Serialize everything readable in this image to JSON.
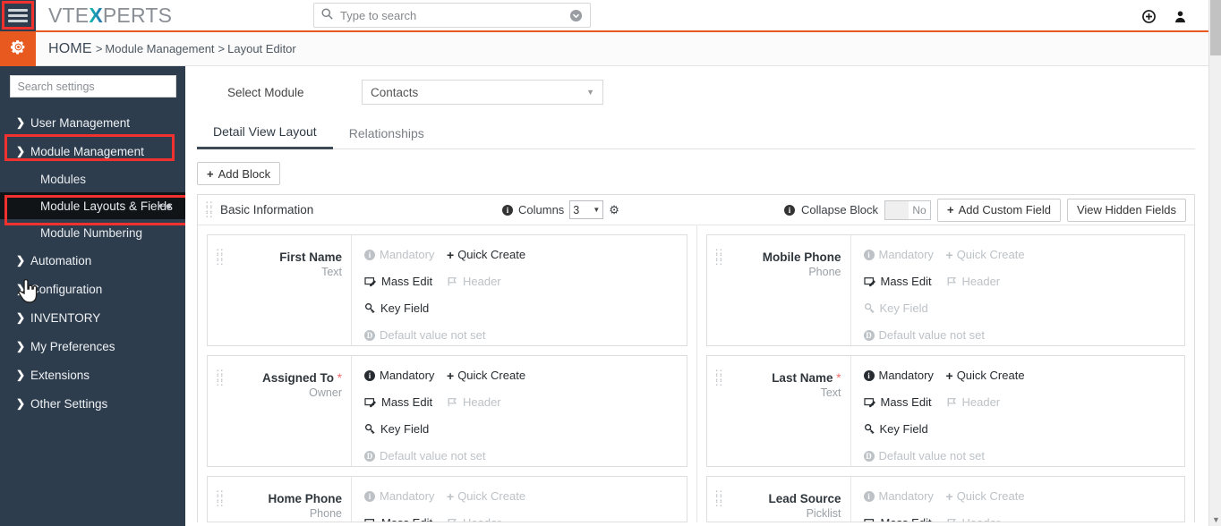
{
  "topbar": {
    "menu_icon": "hamburger-icon",
    "logo_part1": "VTE",
    "logo_x": "X",
    "logo_part2": "PERTS",
    "search_placeholder": "Type to search",
    "search_value": "",
    "search_icon": "search-icon",
    "search_dropdown_icon": "chevron-down-circle-icon",
    "add_icon": "plus-circle-icon",
    "user_icon": "user-icon"
  },
  "breadcrumb": {
    "gear_icon": "gear-icon",
    "home": "HOME",
    "sep": ">",
    "segments": [
      "Module Management",
      "Layout Editor"
    ]
  },
  "sidebar": {
    "search_placeholder": "Search settings",
    "search_value": "",
    "items": [
      {
        "label": "User Management",
        "icon": "chevron-right-icon",
        "expanded": false
      },
      {
        "label": "Module Management",
        "icon": "chevron-down-icon",
        "expanded": true
      },
      {
        "label": "Automation",
        "icon": "chevron-right-icon",
        "expanded": false
      },
      {
        "label": "Configuration",
        "icon": "chevron-right-icon",
        "expanded": false
      },
      {
        "label": "INVENTORY",
        "icon": "chevron-right-icon",
        "expanded": false
      },
      {
        "label": "My Preferences",
        "icon": "chevron-right-icon",
        "expanded": false
      },
      {
        "label": "Extensions",
        "icon": "chevron-right-icon",
        "expanded": false
      },
      {
        "label": "Other Settings",
        "icon": "chevron-right-icon",
        "expanded": false
      }
    ],
    "subitems": [
      {
        "label": "Modules",
        "active": false
      },
      {
        "label": "Module Layouts & Fields",
        "active": true,
        "pin_icon": "pin-icon"
      },
      {
        "label": "Module Numbering",
        "active": false
      }
    ],
    "cursor_icon": "hand-cursor-icon",
    "highlight_color": "#f0312e"
  },
  "main": {
    "select_module_label": "Select Module",
    "selected_module": "Contacts",
    "select_caret_icon": "caret-down-icon",
    "tabs": [
      {
        "label": "Detail View Layout",
        "active": true
      },
      {
        "label": "Relationships",
        "active": false
      }
    ],
    "add_block_label": "Add Block",
    "block": {
      "drag_icon": "drag-handle-icon",
      "title": "Basic Information",
      "columns_info_icon": "info-icon",
      "columns_label": "Columns",
      "columns_value": "3",
      "block_settings_icon": "gear-icon",
      "collapse_info_icon": "info-icon",
      "collapse_label": "Collapse Block",
      "collapse_value": "No",
      "add_custom_field_label": "Add Custom Field",
      "view_hidden_fields_label": "View Hidden Fields"
    },
    "option_labels": {
      "mandatory": "Mandatory",
      "quick_create": "Quick Create",
      "mass_edit": "Mass Edit",
      "header": "Header",
      "key_field": "Key Field",
      "default_value": "Default value not set"
    },
    "fields_left": [
      {
        "name": "First Name",
        "required": false,
        "type": "Text",
        "partial": false,
        "mandatory": false,
        "quick_create": true,
        "mass_edit": true,
        "header": false,
        "key_field": true,
        "default_value": false
      },
      {
        "name": "Assigned To",
        "required": true,
        "type": "Owner",
        "partial": false,
        "mandatory": true,
        "quick_create": true,
        "mass_edit": true,
        "header": false,
        "key_field": true,
        "default_value": false
      },
      {
        "name": "Home Phone",
        "required": false,
        "type": "Phone",
        "partial": true,
        "mandatory": false,
        "quick_create": false,
        "mass_edit": true,
        "header": false,
        "key_field": false,
        "default_value": false
      }
    ],
    "fields_right": [
      {
        "name": "Mobile Phone",
        "required": false,
        "type": "Phone",
        "partial": false,
        "mandatory": false,
        "quick_create": false,
        "mass_edit": true,
        "header": false,
        "key_field": false,
        "default_value": false
      },
      {
        "name": "Last Name",
        "required": true,
        "type": "Text",
        "partial": false,
        "mandatory": true,
        "quick_create": true,
        "mass_edit": true,
        "header": false,
        "key_field": true,
        "default_value": false
      },
      {
        "name": "Lead Source",
        "required": false,
        "type": "Picklist",
        "partial": true,
        "mandatory": false,
        "quick_create": false,
        "mass_edit": true,
        "header": false,
        "key_field": false,
        "default_value": false
      }
    ]
  },
  "scrollbar": {
    "arrow_icon": "scroll-down-arrow-icon"
  },
  "colors": {
    "accent": "#e8591f",
    "sidebar_bg": "#2e3d4d",
    "highlight": "#f0312e"
  }
}
